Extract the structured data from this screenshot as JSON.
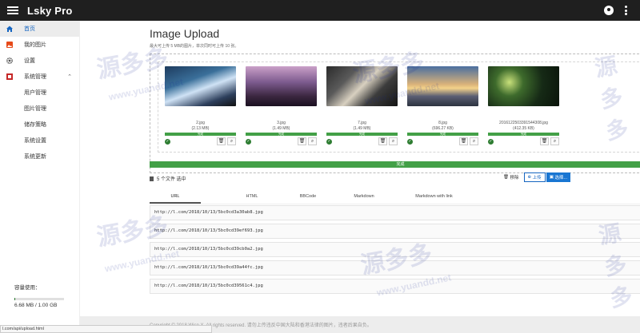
{
  "app": {
    "title": "Lsky Pro"
  },
  "sidebar": {
    "items": [
      {
        "label": "首页",
        "icon": "home-icon"
      },
      {
        "label": "我的图片",
        "icon": "image-icon"
      },
      {
        "label": "设置",
        "icon": "gear-icon"
      },
      {
        "label": "系统管理",
        "icon": "admin-icon"
      }
    ],
    "subitems": [
      "用户管理",
      "图片管理",
      "储存策略",
      "系统设置",
      "系统更新"
    ],
    "storage_label": "容量使用：",
    "storage_value": "6.68 MB / 1.00 GB",
    "storage_fraction": 0.0065
  },
  "page": {
    "title": "Image Upload",
    "subtitle": "最大可上传 5 MB的图片，单次同时可上传 10 张。"
  },
  "uploads": [
    {
      "name": "2.jpg",
      "size": "(2.13 MB)",
      "progress": "完成"
    },
    {
      "name": "3.jpg",
      "size": "(1.49 MB)",
      "progress": "完成"
    },
    {
      "name": "7.jpg",
      "size": "(1.49 MB)",
      "progress": "完成"
    },
    {
      "name": "8.jpg",
      "size": "(696.27 KB)",
      "progress": "完成"
    },
    {
      "name": "2016122503391544308.jpg",
      "size": "(412.35 KB)",
      "progress": "完成"
    }
  ],
  "overall": {
    "progress_label": "完成",
    "file_count": "5 个文件 选中"
  },
  "actions": {
    "remove": "移除",
    "upload": "上传",
    "select": "选择..."
  },
  "tabs": [
    "URL",
    "HTML",
    "BBCode",
    "Markdown",
    "Markdown with link"
  ],
  "links": [
    "http://l.com/2018/10/13/5bc0cd3a30ab8.jpg",
    "http://l.com/2018/10/13/5bc0cd39ef693.jpg",
    "http://l.com/2018/10/13/5bc0cd39cb0a2.jpg",
    "http://l.com/2018/10/13/5bc0cd39a44fc.jpg",
    "http://l.com/2018/10/13/5bc0cd39561c4.jpg"
  ],
  "footer": {
    "text": "Copyright © 2018 Wisp X. All rights reserved. 请勿上传违反中国大陆和香港法律的图片，违者后果自负。"
  },
  "status_url": "l.com/api/upload.html",
  "watermark": {
    "text": "源多多",
    "url": "www.yuandd.net"
  },
  "colors": {
    "appbar": "#1f1f1f",
    "accent": "#1976d2",
    "success": "#43a047"
  }
}
